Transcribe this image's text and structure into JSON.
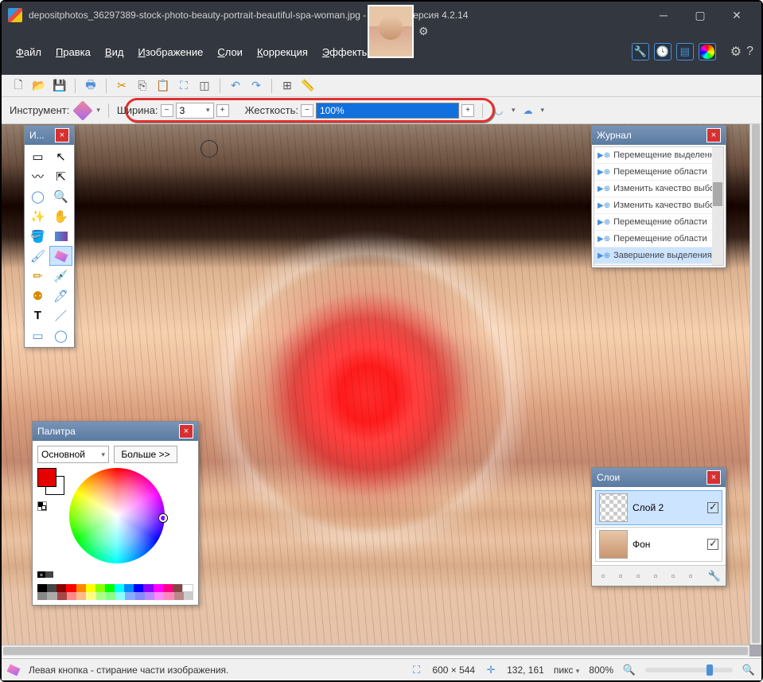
{
  "title": "depositphotos_36297389-stock-photo-beauty-portrait-beautiful-spa-woman.jpg - paint.net версия 4.2.14",
  "menu": {
    "file": "Файл",
    "edit": "Правка",
    "view": "Вид",
    "image": "Изображение",
    "layers": "Слои",
    "correction": "Коррекция",
    "effects": "Эффекты"
  },
  "tool_options": {
    "instrument_label": "Инструмент:",
    "width_label": "Ширина:",
    "width_value": "3",
    "hardness_label": "Жесткость:",
    "hardness_value": "100%"
  },
  "panels": {
    "tools_title": "И...",
    "history_title": "Журнал",
    "palette_title": "Палитра",
    "layers_title": "Слои"
  },
  "history": {
    "items": [
      "Перемещение выделенной области",
      "Перемещение области",
      "Изменить качество выбора",
      "Изменить качество выбора",
      "Перемещение области",
      "Перемещение области",
      "Завершение выделения"
    ],
    "selected_index": 6
  },
  "palette": {
    "mode": "Основной",
    "more": "Больше >>",
    "primary_color": "#e60000",
    "secondary_color": "#ffffff"
  },
  "layers": {
    "items": [
      {
        "name": "Слой 2",
        "visible": true,
        "selected": true,
        "bg": false
      },
      {
        "name": "Фон",
        "visible": true,
        "selected": false,
        "bg": true
      }
    ]
  },
  "statusbar": {
    "hint": "Левая кнопка - стирание части изображения.",
    "dimensions": "600 × 544",
    "coords": "132, 161",
    "units": "пикс",
    "zoom": "800%"
  }
}
